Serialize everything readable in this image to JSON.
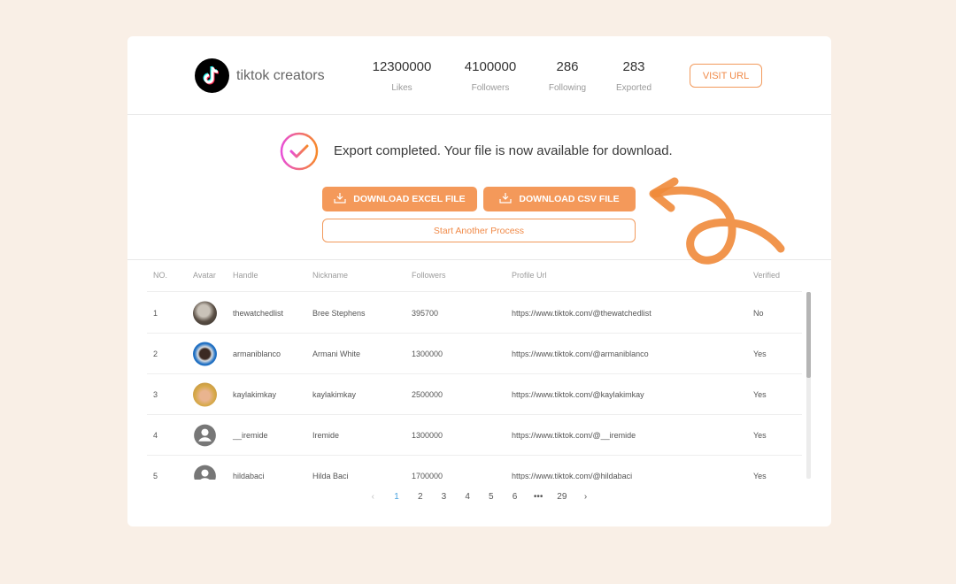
{
  "header": {
    "brand_name": "tiktok creators",
    "logo_icon": "tiktok-logo-icon",
    "stats": [
      {
        "value": "12300000",
        "label": "Likes"
      },
      {
        "value": "4100000",
        "label": "Followers"
      },
      {
        "value": "286",
        "label": "Following"
      },
      {
        "value": "283",
        "label": "Exported"
      }
    ],
    "visit_button": "VISIT URL"
  },
  "export": {
    "status_icon": "check-circle-icon",
    "message": "Export completed. Your file is now available for download.",
    "download_excel": "DOWNLOAD EXCEL FILE",
    "download_csv": "DOWNLOAD CSV FILE",
    "download_icon": "download-icon",
    "restart_button": "Start Another Process",
    "accent_color": "#f4995a"
  },
  "table": {
    "columns": [
      "NO.",
      "Avatar",
      "Handle",
      "Nickname",
      "Followers",
      "Profile Url",
      "Verified"
    ],
    "rows": [
      {
        "no": "1",
        "avatar": "photo",
        "handle": "thewatchedlist",
        "nickname": "Bree Stephens",
        "followers": "395700",
        "url": "https://www.tiktok.com/@thewatchedlist",
        "verified": "No"
      },
      {
        "no": "2",
        "avatar": "photo",
        "handle": "armaniblanco",
        "nickname": "Armani White",
        "followers": "1300000",
        "url": "https://www.tiktok.com/@armaniblanco",
        "verified": "Yes"
      },
      {
        "no": "3",
        "avatar": "photo",
        "handle": "kaylakimkay",
        "nickname": "kaylakimkay",
        "followers": "2500000",
        "url": "https://www.tiktok.com/@kaylakimkay",
        "verified": "Yes"
      },
      {
        "no": "4",
        "avatar": "default",
        "handle": "__iremide",
        "nickname": "Iremide",
        "followers": "1300000",
        "url": "https://www.tiktok.com/@__iremide",
        "verified": "Yes"
      },
      {
        "no": "5",
        "avatar": "default",
        "handle": "hildabaci",
        "nickname": "Hilda Baci",
        "followers": "1700000",
        "url": "https://www.tiktok.com/@hildabaci",
        "verified": "Yes"
      }
    ]
  },
  "pagination": {
    "prev": "‹",
    "pages": [
      "1",
      "2",
      "3",
      "4",
      "5",
      "6",
      "•••",
      "29"
    ],
    "current": "1",
    "next": "›"
  }
}
